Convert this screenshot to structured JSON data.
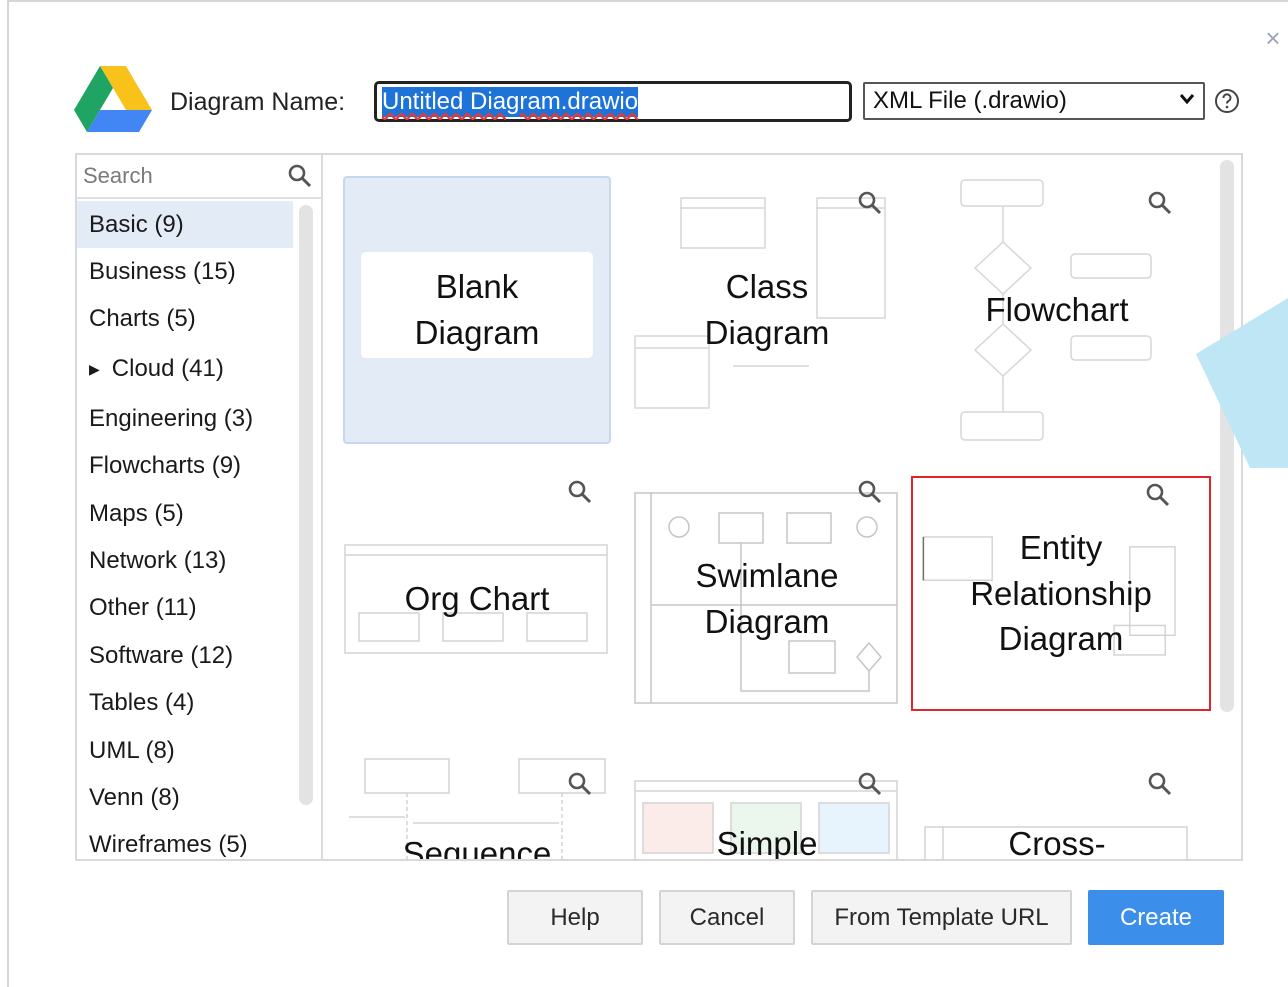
{
  "dialog": {
    "name_label": "Diagram Name:",
    "name_value": "Untitled Diagram.drawio",
    "format_value": "XML File (.drawio)",
    "search_placeholder": "Search"
  },
  "categories": [
    {
      "label": "Basic (9)"
    },
    {
      "label": "Business (15)"
    },
    {
      "label": "Charts (5)"
    },
    {
      "label": "Cloud (41)"
    },
    {
      "label": "Engineering (3)"
    },
    {
      "label": "Flowcharts (9)"
    },
    {
      "label": "Maps (5)"
    },
    {
      "label": "Network (13)"
    },
    {
      "label": "Other (11)"
    },
    {
      "label": "Software (12)"
    },
    {
      "label": "Tables (4)"
    },
    {
      "label": "UML (8)"
    },
    {
      "label": "Venn (8)"
    },
    {
      "label": "Wireframes (5)"
    }
  ],
  "templates": [
    {
      "label": "Blank Diagram"
    },
    {
      "label": "Class Diagram"
    },
    {
      "label": "Flowchart"
    },
    {
      "label": "Org Chart"
    },
    {
      "label": "Swimlane Diagram"
    },
    {
      "label": "Entity Relationship Diagram"
    },
    {
      "label": "Sequence"
    },
    {
      "label": "Simple"
    },
    {
      "label": "Cross-"
    }
  ],
  "buttons": {
    "help": "Help",
    "cancel": "Cancel",
    "from_url": "From Template URL",
    "create": "Create"
  },
  "colors": {
    "accent": "#3b8eea",
    "selection_border": "#e0242b",
    "active_bg": "#e3ebf7"
  }
}
